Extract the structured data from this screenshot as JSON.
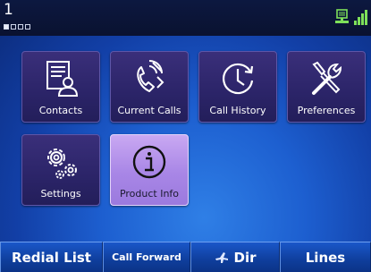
{
  "status": {
    "line_number": "1",
    "line_indicators": [
      true,
      false,
      false,
      false
    ]
  },
  "tiles": [
    {
      "label": "Contacts",
      "icon": "contacts-icon",
      "selected": false
    },
    {
      "label": "Current Calls",
      "icon": "current-calls-icon",
      "selected": false
    },
    {
      "label": "Call History",
      "icon": "call-history-icon",
      "selected": false
    },
    {
      "label": "Preferences",
      "icon": "preferences-icon",
      "selected": false
    },
    {
      "label": "Settings",
      "icon": "settings-icon",
      "selected": false
    },
    {
      "label": "Product Info",
      "icon": "info-icon",
      "selected": true
    }
  ],
  "softkeys": [
    {
      "label": "Redial List"
    },
    {
      "label": "Call Forward"
    },
    {
      "label": "Dir",
      "icon": "airplane-icon"
    },
    {
      "label": "Lines"
    }
  ],
  "colors": {
    "background": "#1d5fd0",
    "tile": "#2b2468",
    "tile_selected": "#a886e6",
    "softkey": "#0f3e9c",
    "signal": "#7ee05a"
  }
}
